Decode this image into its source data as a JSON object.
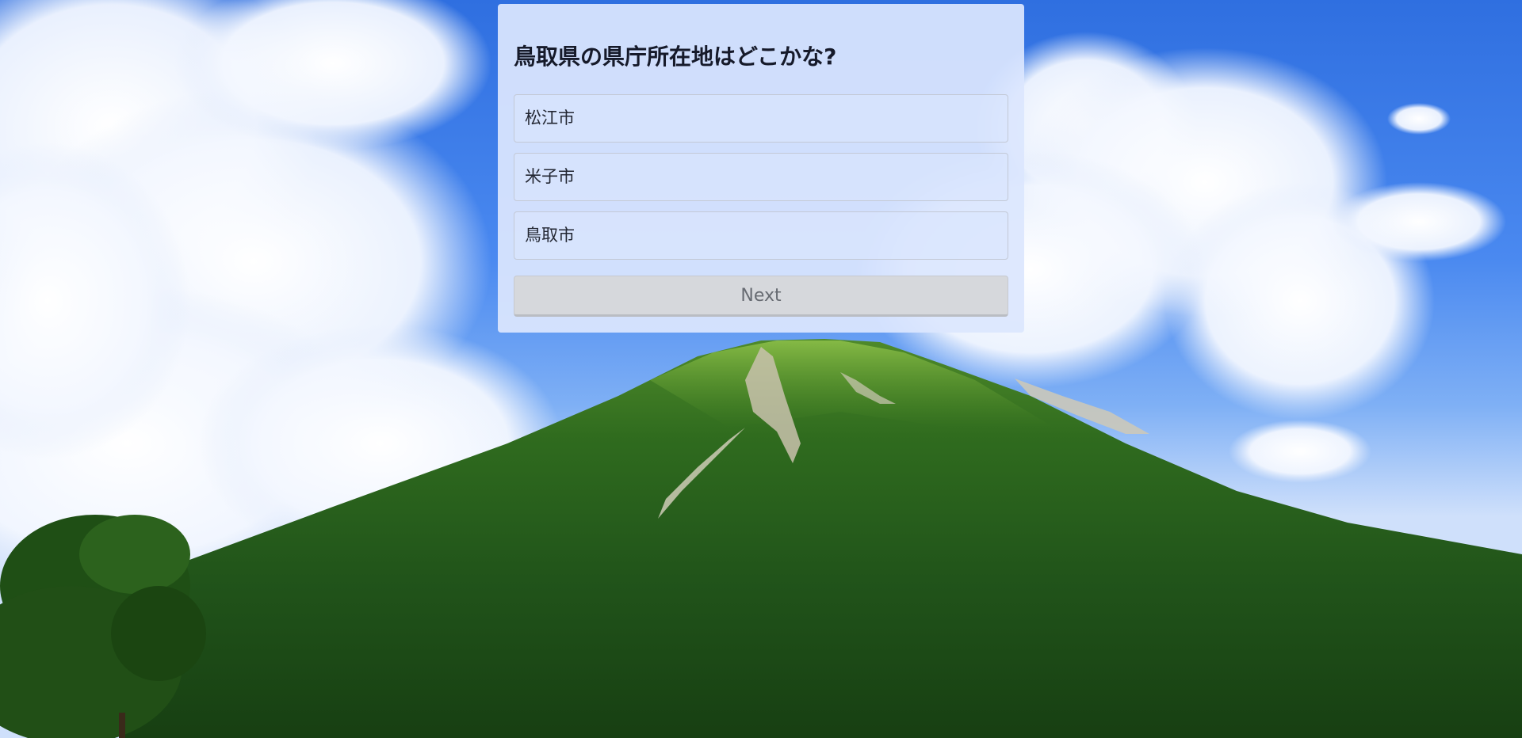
{
  "background": {
    "image_semantic": "mountain-landscape-photo",
    "sky_color": "#3a78e6",
    "mountain_color": "#2a5e1a"
  },
  "quiz": {
    "question": "鳥取県の県庁所在地はどこかな?",
    "options": [
      {
        "label": "松江市"
      },
      {
        "label": "米子市"
      },
      {
        "label": "鳥取市"
      }
    ],
    "next_label": "Next"
  }
}
